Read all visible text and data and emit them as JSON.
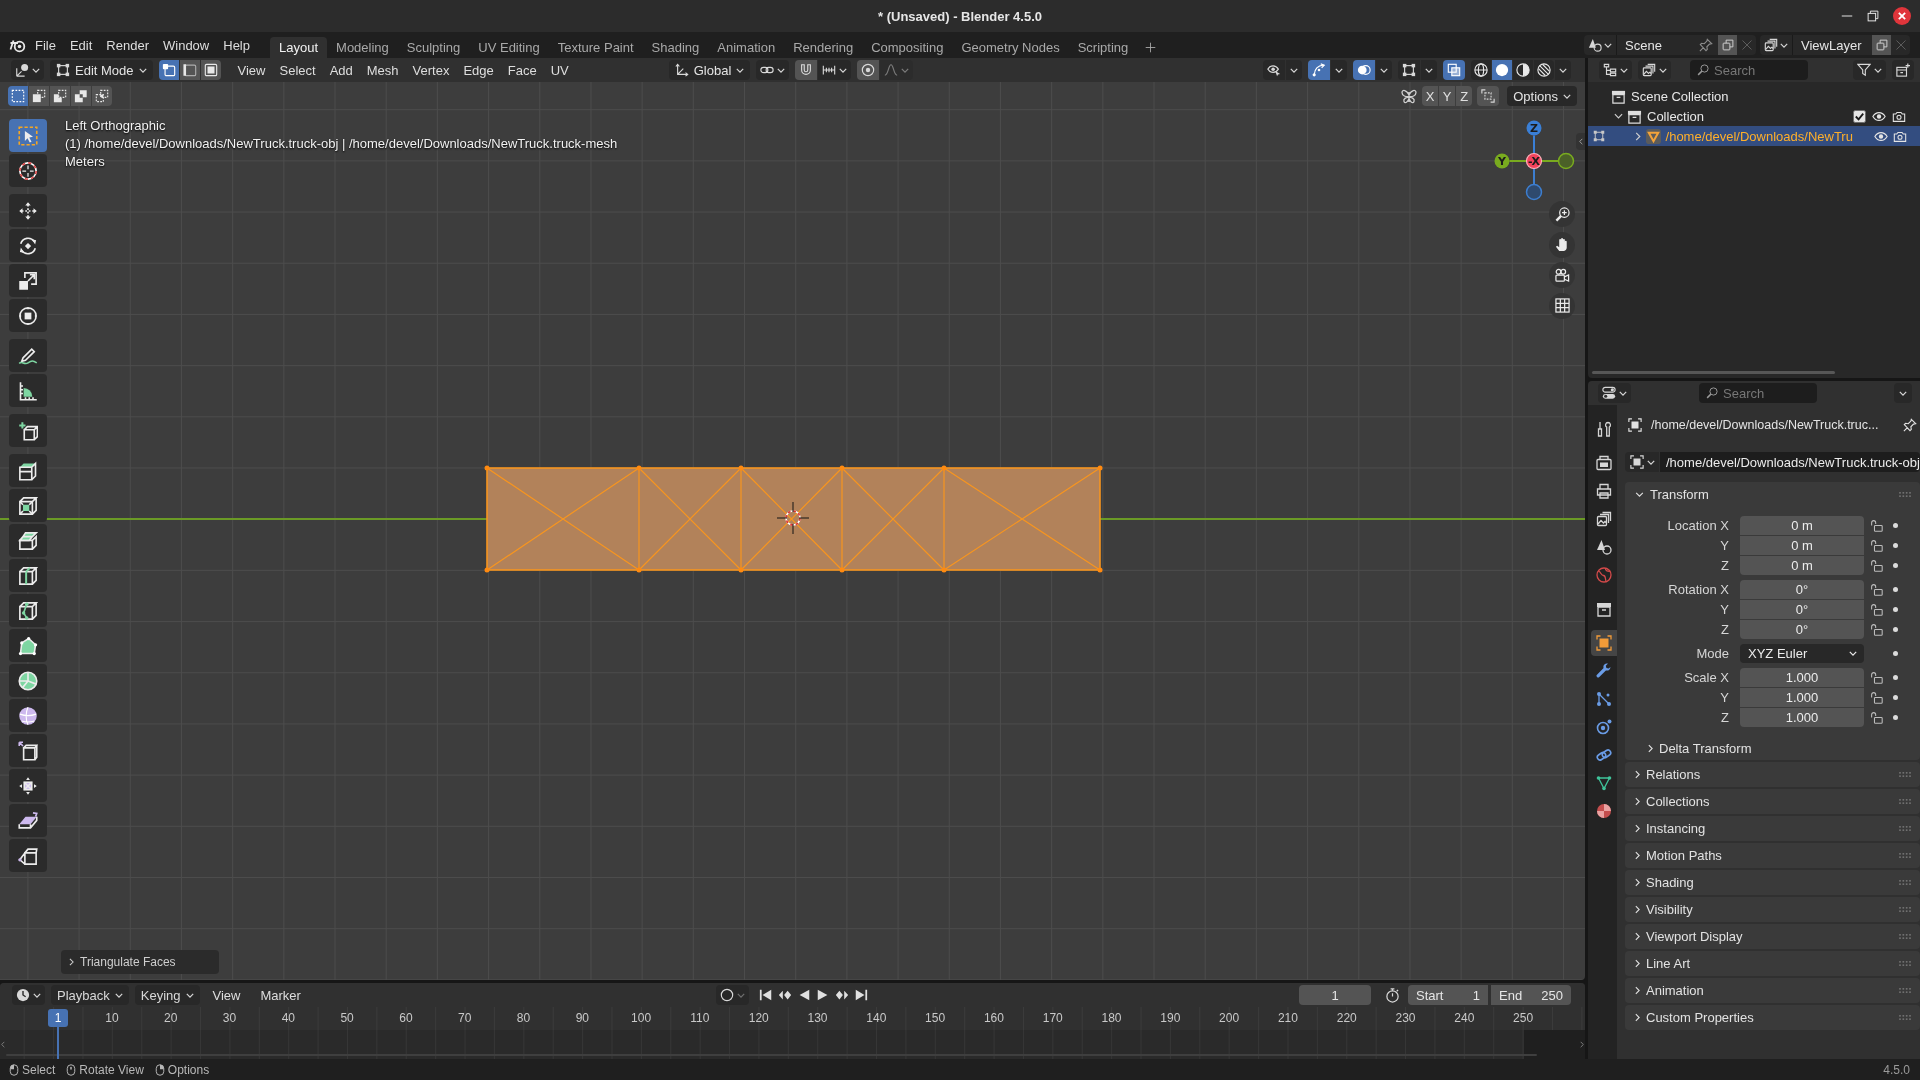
{
  "window": {
    "title": "* (Unsaved) - Blender 4.5.0"
  },
  "menu": [
    "File",
    "Edit",
    "Render",
    "Window",
    "Help"
  ],
  "workspaces": [
    {
      "label": "Layout",
      "selected": true
    },
    {
      "label": "Modeling",
      "selected": false
    },
    {
      "label": "Sculpting",
      "selected": false
    },
    {
      "label": "UV Editing",
      "selected": false
    },
    {
      "label": "Texture Paint",
      "selected": false
    },
    {
      "label": "Shading",
      "selected": false
    },
    {
      "label": "Animation",
      "selected": false
    },
    {
      "label": "Rendering",
      "selected": false
    },
    {
      "label": "Compositing",
      "selected": false
    },
    {
      "label": "Geometry Nodes",
      "selected": false
    },
    {
      "label": "Scripting",
      "selected": false
    }
  ],
  "scene": {
    "name": "Scene"
  },
  "view_layer": {
    "name": "ViewLayer"
  },
  "viewport_header": {
    "mode": "Edit Mode",
    "select_modes": [
      {
        "kind": "vertex",
        "selected": true
      },
      {
        "kind": "edge",
        "selected": false
      },
      {
        "kind": "face",
        "selected": false
      }
    ],
    "menus": [
      "View",
      "Select",
      "Add",
      "Mesh",
      "Vertex",
      "Edge",
      "Face",
      "UV"
    ],
    "orientation": "Global",
    "toggles": [
      {
        "kind": "selectability",
        "on": false
      },
      {
        "kind": "gizmos",
        "on": true
      },
      {
        "kind": "overlays",
        "on": true
      },
      {
        "kind": "mesh-overlays",
        "on": false
      },
      {
        "kind": "xray",
        "on": true
      }
    ],
    "shading": [
      {
        "kind": "wireframe",
        "selected": false
      },
      {
        "kind": "solid",
        "selected": true
      },
      {
        "kind": "material",
        "selected": false
      },
      {
        "kind": "rendered",
        "selected": false
      }
    ]
  },
  "tool_settings": {
    "select_ops": [
      {
        "kind": "set",
        "selected": true
      },
      {
        "kind": "extend",
        "selected": false
      },
      {
        "kind": "subtract",
        "selected": false
      },
      {
        "kind": "invert",
        "selected": false
      },
      {
        "kind": "intersect",
        "selected": false
      }
    ],
    "mirror_axes": [
      {
        "label": "X",
        "on": false
      },
      {
        "label": "Y",
        "on": false
      },
      {
        "label": "Z",
        "on": false
      }
    ],
    "options": "Options"
  },
  "viewport": {
    "info": [
      "Left Orthographic",
      "(1) /home/devel/Downloads/NewTruck.truck-obj | /home/devel/Downloads/NewTruck.truck-mesh",
      "Meters"
    ],
    "tool_groups": [
      {
        "tools": [
          {
            "kind": "select-box",
            "selected": true
          },
          {
            "kind": "cursor",
            "selected": false
          }
        ]
      },
      {
        "tools": [
          {
            "kind": "move",
            "selected": false
          },
          {
            "kind": "rotate",
            "selected": false
          },
          {
            "kind": "scale",
            "selected": false
          },
          {
            "kind": "transform",
            "selected": false
          }
        ]
      },
      {
        "tools": [
          {
            "kind": "annotate",
            "selected": false
          },
          {
            "kind": "measure",
            "selected": false
          }
        ]
      },
      {
        "tools": [
          {
            "kind": "add-cube",
            "selected": false
          }
        ]
      },
      {
        "tools": [
          {
            "kind": "extrude",
            "selected": false
          },
          {
            "kind": "inset",
            "selected": false
          },
          {
            "kind": "bevel",
            "selected": false
          },
          {
            "kind": "loop-cut",
            "selected": false
          },
          {
            "kind": "knife",
            "selected": false
          },
          {
            "kind": "poly-build",
            "selected": false
          },
          {
            "kind": "spin",
            "selected": false
          },
          {
            "kind": "smooth",
            "selected": false
          },
          {
            "kind": "edge-slide",
            "selected": false
          },
          {
            "kind": "shrink-fatten",
            "selected": false
          },
          {
            "kind": "shear",
            "selected": false
          },
          {
            "kind": "rip",
            "selected": false
          }
        ]
      }
    ],
    "axes": [
      {
        "label": "Z",
        "color": "#3a7fd6"
      },
      {
        "label": "Y",
        "color": "#79ab1f"
      },
      {
        "label": "-X",
        "color": "#f3425b"
      }
    ],
    "operator_panel": {
      "title": "Triangulate Faces",
      "expanded": false
    }
  },
  "timeline": {
    "menus": [
      {
        "label": "Playback",
        "kind": "dropdown"
      },
      {
        "label": "Keying",
        "kind": "dropdown"
      },
      {
        "label": "View",
        "kind": "menu"
      },
      {
        "label": "Marker",
        "kind": "menu"
      }
    ],
    "current_frame": "1",
    "start_label": "Start",
    "start": "1",
    "end_label": "End",
    "end": "250",
    "playhead": "1",
    "ruler": [
      "10",
      "20",
      "30",
      "40",
      "50",
      "60",
      "70",
      "80",
      "90",
      "100",
      "110",
      "120",
      "130",
      "140",
      "150",
      "160",
      "170",
      "180",
      "190",
      "200",
      "210",
      "220",
      "230",
      "240",
      "250"
    ]
  },
  "outliner": {
    "search": {
      "placeholder": "Search"
    },
    "tree": [
      {
        "label": "Scene Collection",
        "kind": "scene-collection",
        "selected": false,
        "children": [
          {
            "label": "Collection",
            "kind": "collection",
            "expanded": true,
            "checked": true,
            "selected": false,
            "children": [
              {
                "label": "/home/devel/Downloads/NewTru",
                "kind": "mesh-object",
                "expanded": false,
                "selected": true
              }
            ]
          }
        ]
      }
    ]
  },
  "properties": {
    "search": {
      "placeholder": "Search"
    },
    "tab_groups": [
      {
        "tabs": [
          {
            "kind": "tool",
            "selected": false
          }
        ]
      },
      {
        "tabs": [
          {
            "kind": "render",
            "selected": false
          },
          {
            "kind": "output",
            "selected": false
          },
          {
            "kind": "view-layer",
            "selected": false
          },
          {
            "kind": "scene",
            "selected": false
          },
          {
            "kind": "world",
            "selected": false
          }
        ]
      },
      {
        "tabs": [
          {
            "kind": "collection",
            "selected": false
          }
        ]
      },
      {
        "tabs": [
          {
            "kind": "object",
            "selected": true
          },
          {
            "kind": "modifiers",
            "selected": false
          },
          {
            "kind": "particles",
            "selected": false
          },
          {
            "kind": "physics",
            "selected": false
          },
          {
            "kind": "constraints",
            "selected": false
          },
          {
            "kind": "data",
            "selected": false
          },
          {
            "kind": "material",
            "selected": false
          }
        ]
      }
    ],
    "context": "/home/devel/Downloads/NewTruck.truc...",
    "object_name": "/home/devel/Downloads/NewTruck.truck-obj",
    "panels": [
      {
        "title": "Transform",
        "expanded": true,
        "groups": [
          {
            "rows": [
              {
                "label": "Location X",
                "value": "0 m",
                "kind": "number"
              },
              {
                "label": "Y",
                "value": "0 m",
                "kind": "number"
              },
              {
                "label": "Z",
                "value": "0 m",
                "kind": "number"
              }
            ]
          },
          {
            "rows": [
              {
                "label": "Rotation X",
                "value": "0°",
                "kind": "number"
              },
              {
                "label": "Y",
                "value": "0°",
                "kind": "number"
              },
              {
                "label": "Z",
                "value": "0°",
                "kind": "number"
              }
            ]
          },
          {
            "rows": [
              {
                "label": "Mode",
                "value": "XYZ Euler",
                "kind": "dropdown"
              }
            ]
          },
          {
            "rows": [
              {
                "label": "Scale X",
                "value": "1.000",
                "kind": "number"
              },
              {
                "label": "Y",
                "value": "1.000",
                "kind": "number"
              },
              {
                "label": "Z",
                "value": "1.000",
                "kind": "number"
              }
            ]
          }
        ],
        "subpanels": [
          {
            "title": "Delta Transform",
            "expanded": false
          }
        ]
      },
      {
        "title": "Relations",
        "expanded": false
      },
      {
        "title": "Collections",
        "expanded": false
      },
      {
        "title": "Instancing",
        "expanded": false
      },
      {
        "title": "Motion Paths",
        "expanded": false
      },
      {
        "title": "Shading",
        "expanded": false
      },
      {
        "title": "Visibility",
        "expanded": false
      },
      {
        "title": "Viewport Display",
        "expanded": false
      },
      {
        "title": "Line Art",
        "expanded": false
      },
      {
        "title": "Animation",
        "expanded": false
      },
      {
        "title": "Custom Properties",
        "expanded": false
      }
    ]
  },
  "status_bar": {
    "hints": [
      {
        "kind": "left",
        "label": "Select"
      },
      {
        "kind": "middle",
        "label": "Rotate View"
      },
      {
        "kind": "right",
        "label": "Options"
      }
    ],
    "version": "4.5.0"
  }
}
